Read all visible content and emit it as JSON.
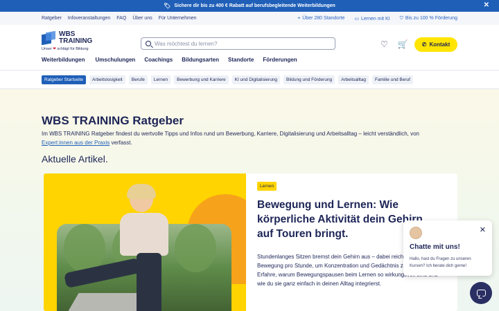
{
  "promo": {
    "text": "Sichere dir bis zu 400 € Rabatt auf berufsbegleitende Weiterbildungen",
    "icon": "tag-icon",
    "close_icon": "close-icon"
  },
  "util_bar": {
    "left_links": [
      "Ratgeber",
      "Infoveranstaltungen",
      "FAQ",
      "Über uns",
      "Für Unternehmen"
    ],
    "right_links": [
      {
        "icon": "location-pin-icon",
        "label": "Über 280 Standorte"
      },
      {
        "icon": "laptop-icon",
        "label": "Lernen mit KI"
      },
      {
        "icon": "shield-icon",
        "label": "Bis zu 100 % Förderung"
      }
    ]
  },
  "header": {
    "logo_text_1": "WBS",
    "logo_text_2": "TRAINING",
    "slogan_before": "Unser",
    "slogan_after": "schlägt für Bildung",
    "search_placeholder": "Was möchtest du lernen?",
    "contact_label": "Kontakt"
  },
  "main_nav": [
    "Weiterbildungen",
    "Umschulungen",
    "Coachings",
    "Bildungsarten",
    "Standorte",
    "Förderungen"
  ],
  "sub_nav": [
    "Ratgeber Startseite",
    "Arbeitslosigkeit",
    "Berufe",
    "Lernen",
    "Bewerbung und Karriere",
    "KI und Digitalisierung",
    "Bildung und Förderung",
    "Arbeitsalltag",
    "Familie und Beruf"
  ],
  "hero": {
    "title": "WBS TRAINING Ratgeber",
    "intro_text": "Im WBS TRAINING Ratgeber findest du wertvolle Tipps und Infos rund um Bewerbung, Karriere, Digitalisierung und Arbeitsalltag – leicht verständlich, von",
    "intro_link": "Expert:innen aus der Praxis",
    "intro_end": "verfasst.",
    "section_title": "Aktuelle Artikel."
  },
  "article": {
    "badge": "Lernen",
    "title": "Bewegung und Lernen: Wie körperliche Aktivität dein Gehirn auf Touren bringt.",
    "teaser": "Stundenlanges Sitzen bremst dein Gehirn aus – dabei reichen Minuten Bewegung pro Stunde, um Konzentration und Gedächtnis zu steigern. Erfahre, warum Bewegungspausen beim Lernen so wirkungsvoll sind und wie du sie ganz einfach in deinen Alltag integrierst."
  },
  "chat": {
    "title": "Chatte mit uns!",
    "message": "Hallo, hast du Fragen zu unseren Kursen? Ich berate dich gerne!"
  },
  "colors": {
    "brand_blue": "#1f5fb8",
    "navy": "#1d2557",
    "yellow": "#ffd400"
  }
}
